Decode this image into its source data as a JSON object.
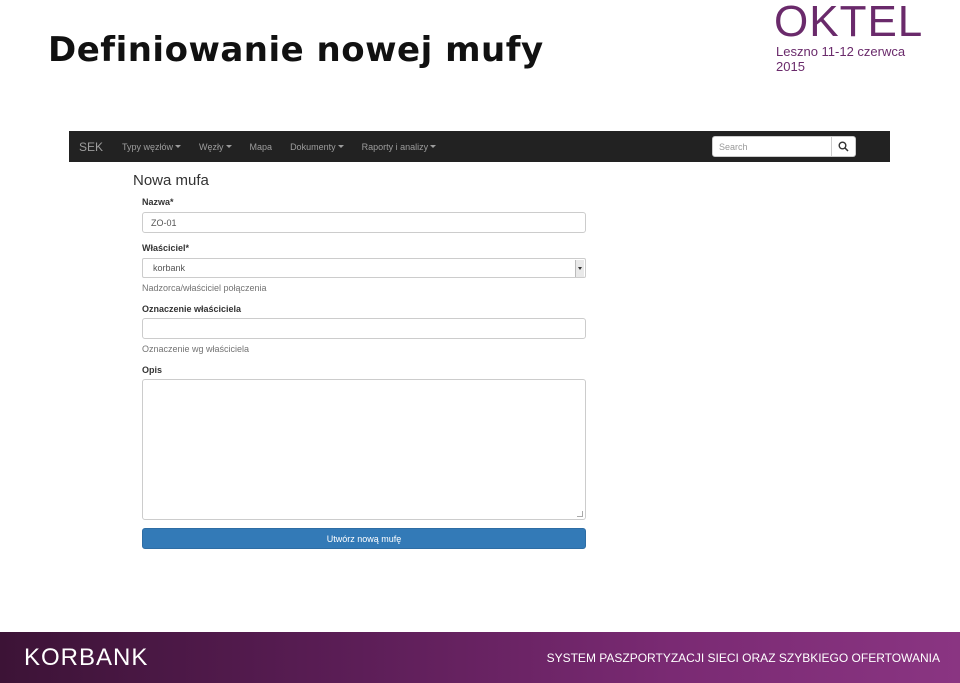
{
  "slide": {
    "title": "Definiowanie nowej mufy",
    "logo_word": "OKTEL",
    "logo_subtitle": "Leszno 11-12 czerwca 2015",
    "footer_brand": "KORBANK",
    "footer_tagline": "SYSTEM PASZPORTYZACJI SIECI ORAZ SZYBKIEGO OFERTOWANIA"
  },
  "navbar": {
    "brand": "SEK",
    "items": [
      {
        "label": "Typy węzłów",
        "dropdown": true
      },
      {
        "label": "Węzły",
        "dropdown": true
      },
      {
        "label": "Mapa",
        "dropdown": false
      },
      {
        "label": "Dokumenty",
        "dropdown": true
      },
      {
        "label": "Raporty i analizy",
        "dropdown": true
      }
    ],
    "search_placeholder": "Search",
    "search_icon": "search-icon"
  },
  "form": {
    "title": "Nowa mufa",
    "name_label": "Nazwa*",
    "name_value": "ZO-01",
    "owner_label": "Właściciel*",
    "owner_value": "korbank",
    "owner_help": "Nadzorca/właściciel połączenia",
    "owner_marking_label": "Oznaczenie właściciela",
    "owner_marking_value": "",
    "owner_marking_help": "Oznaczenie wg właściciela",
    "description_label": "Opis",
    "description_value": "",
    "submit_label": "Utwórz nową mufę"
  },
  "colors": {
    "navbar_bg": "#222222",
    "primary_button": "#337ab7",
    "brand_purple": "#6a2a6b"
  }
}
